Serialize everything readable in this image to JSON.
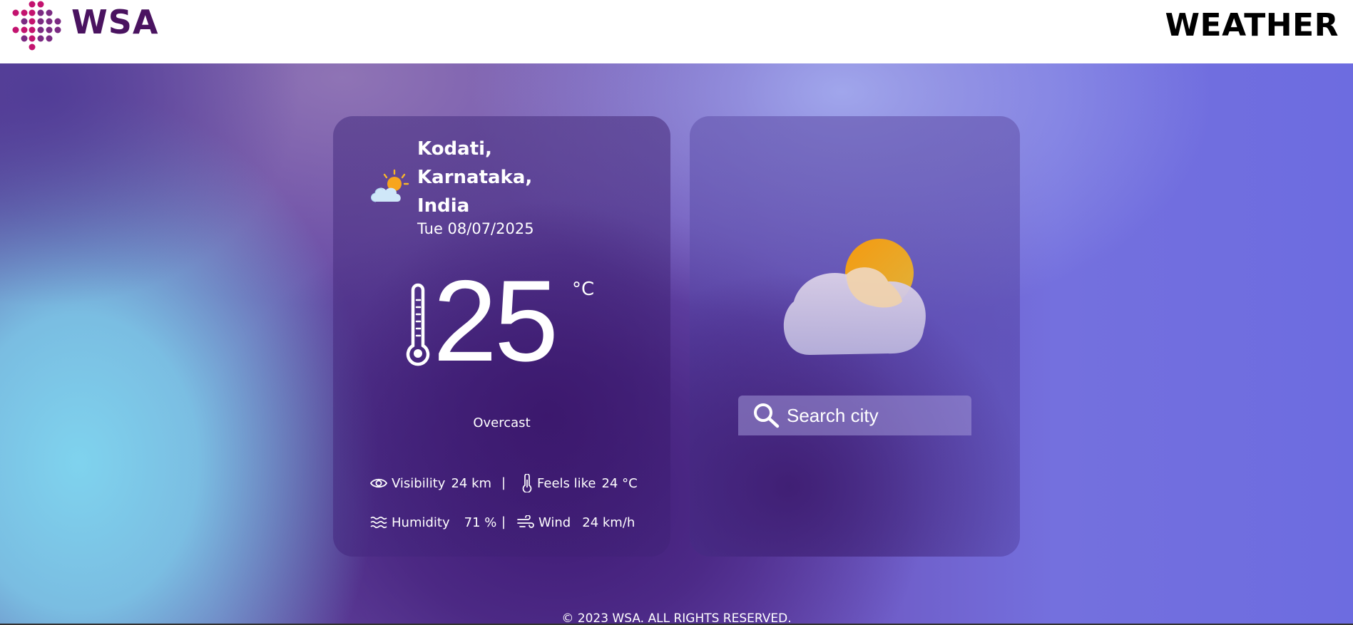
{
  "header": {
    "logo_text": "WSA",
    "title": "WEATHER"
  },
  "weather": {
    "location_line1": "Kodati,",
    "location_line2": "Karnataka,",
    "location_line3": "India",
    "date": "Tue 08/07/2025",
    "temperature": "25",
    "unit": "°C",
    "condition": "Overcast",
    "stats": {
      "visibility_label": "Visibility",
      "visibility_value": "24 km",
      "feels_like_label": "Feels like",
      "feels_like_value": "24 °C",
      "humidity_label": "Humidity",
      "humidity_value": "71 %",
      "wind_label": "Wind",
      "wind_value": "24 km/h",
      "separator": "|"
    }
  },
  "search": {
    "placeholder": "Search city"
  },
  "footer": {
    "copyright": "© 2023 WSA. ALL RIGHTS RESERVED."
  },
  "colors": {
    "logo_magenta": "#c3136f",
    "logo_purple": "#4a1360",
    "sun_orange": "#f2a21a"
  }
}
